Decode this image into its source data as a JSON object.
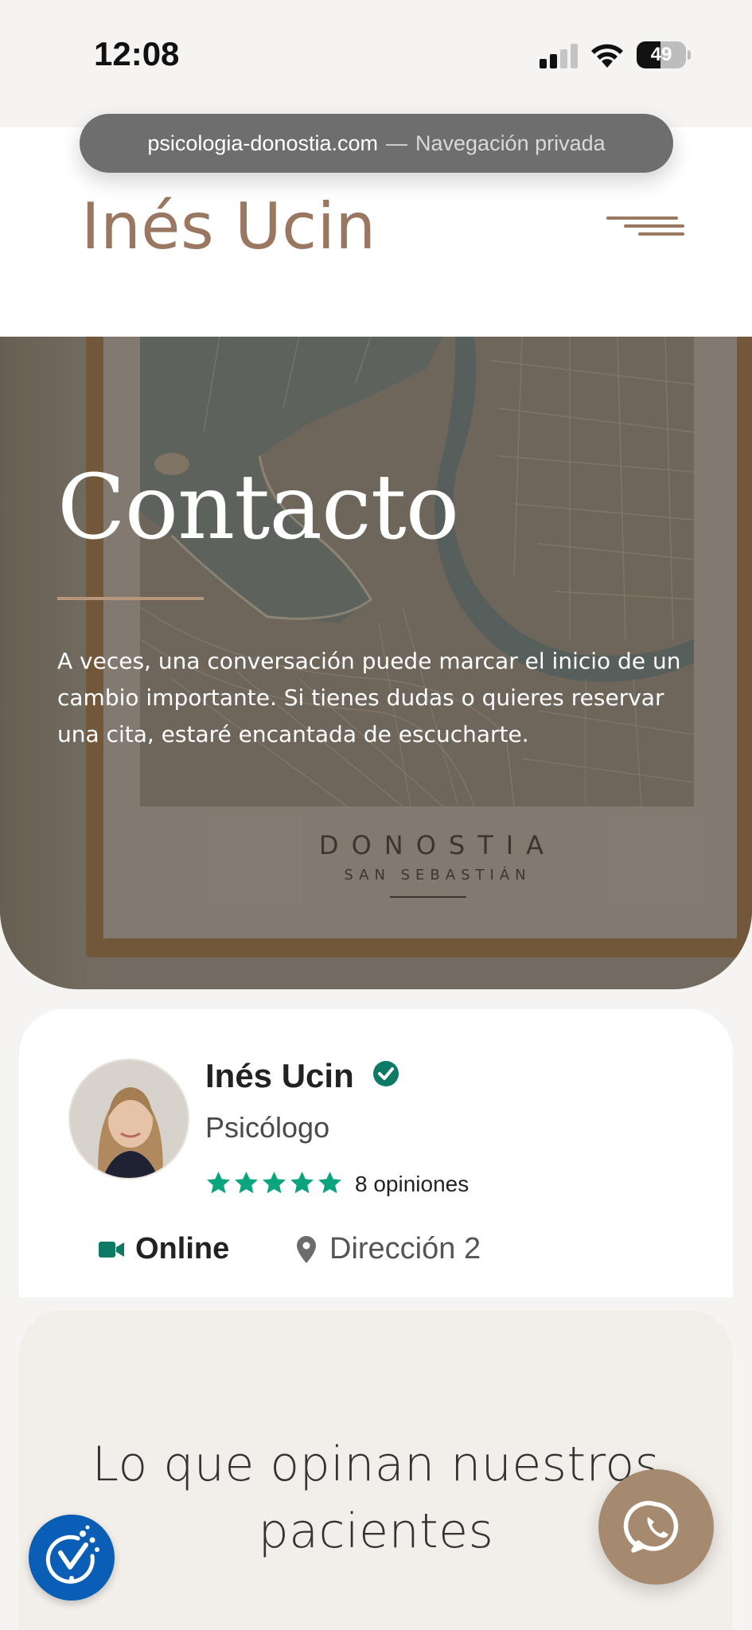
{
  "status_bar": {
    "time": "12:08",
    "battery_percent": "49",
    "battery_level": 0.49,
    "icons": [
      "signal-icon",
      "wifi-icon",
      "battery-icon"
    ]
  },
  "browser": {
    "domain": "psicologia-donostia.com",
    "separator": "—",
    "mode": "Navegación privada"
  },
  "header": {
    "brand": "Inés Ucin",
    "menu_icon": "menu-icon"
  },
  "hero": {
    "title": "Contacto",
    "text": "A veces, una conversación puede marcar el inicio de un cambio importante. Si tienes dudas o quieres reservar una cita, estaré encantada de escucharte.",
    "poster_title": "DONOSTIA",
    "poster_subtitle": "SAN SEBASTIÁN"
  },
  "profile": {
    "name": "Inés Ucin",
    "role": "Psicólogo",
    "rating": 5,
    "reviews": "8 opiniones",
    "online_label": "Online",
    "address_label": "Dirección 2",
    "icons": [
      "verified-icon",
      "star-icon",
      "video-icon",
      "pin-icon"
    ]
  },
  "testimonials": {
    "title_line1": "Lo que opinan nuestros",
    "title_line2": "pacientes"
  },
  "floating": {
    "accessibility_icon": "accessibility-icon",
    "whatsapp_icon": "whatsapp-icon"
  },
  "colors": {
    "brand": "#9a7761",
    "accent_rule": "#b9957a",
    "verified": "#0e7a66",
    "stars": "#0aa57f",
    "whatsapp_button": "#a58a70",
    "accessibility_button": "#0a5eb6",
    "testimonials_bg": "#f2eee9"
  }
}
